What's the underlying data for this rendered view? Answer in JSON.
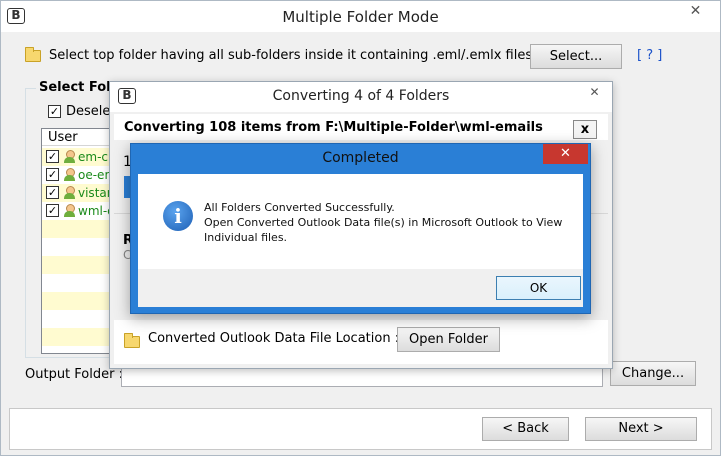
{
  "main": {
    "title": "Multiple Folder Mode",
    "select_prompt": "Select top folder having all sub-folders inside it containing .eml/.emlx files",
    "select_button": "Select...",
    "help_link": "[ ? ]",
    "group_label": "Select Folde",
    "deselect_label": "Deselec",
    "list_header": "User",
    "folders": [
      "em-cli",
      "oe-em",
      "vistan",
      "wml-e"
    ],
    "output_folder_label": "Output Folder :",
    "change_button": "Change...",
    "back_button": "< Back",
    "next_button": "Next >",
    "logo": "B",
    "close_glyph": "✕"
  },
  "converting": {
    "title": "Converting 4 of 4 Folders",
    "header": "Converting 108 items from F:\\Multiple-Folder\\wml-emails",
    "x_label": "x",
    "partial_number": "1",
    "partial_r": "R",
    "partial_c": "C",
    "location_label": "Converted Outlook Data File Location :",
    "open_folder_button": "Open Folder",
    "logo": "B",
    "close_glyph": "✕",
    "progress_color": "#2a7fd6"
  },
  "completed": {
    "title": "Completed",
    "line1": "All Folders Converted Successfully.",
    "line2": "Open Converted Outlook Data file(s) in Microsoft Outlook to View",
    "line3": "Individual files.",
    "ok_button": "OK",
    "icon": "info-icon",
    "icon_glyph": "i",
    "close_glyph": "✕"
  },
  "colors": {
    "accent": "#2a7fd6",
    "close_red": "#c7372f",
    "folder_text_green": "#1a8a1a",
    "row_highlight": "#fffbd0"
  }
}
